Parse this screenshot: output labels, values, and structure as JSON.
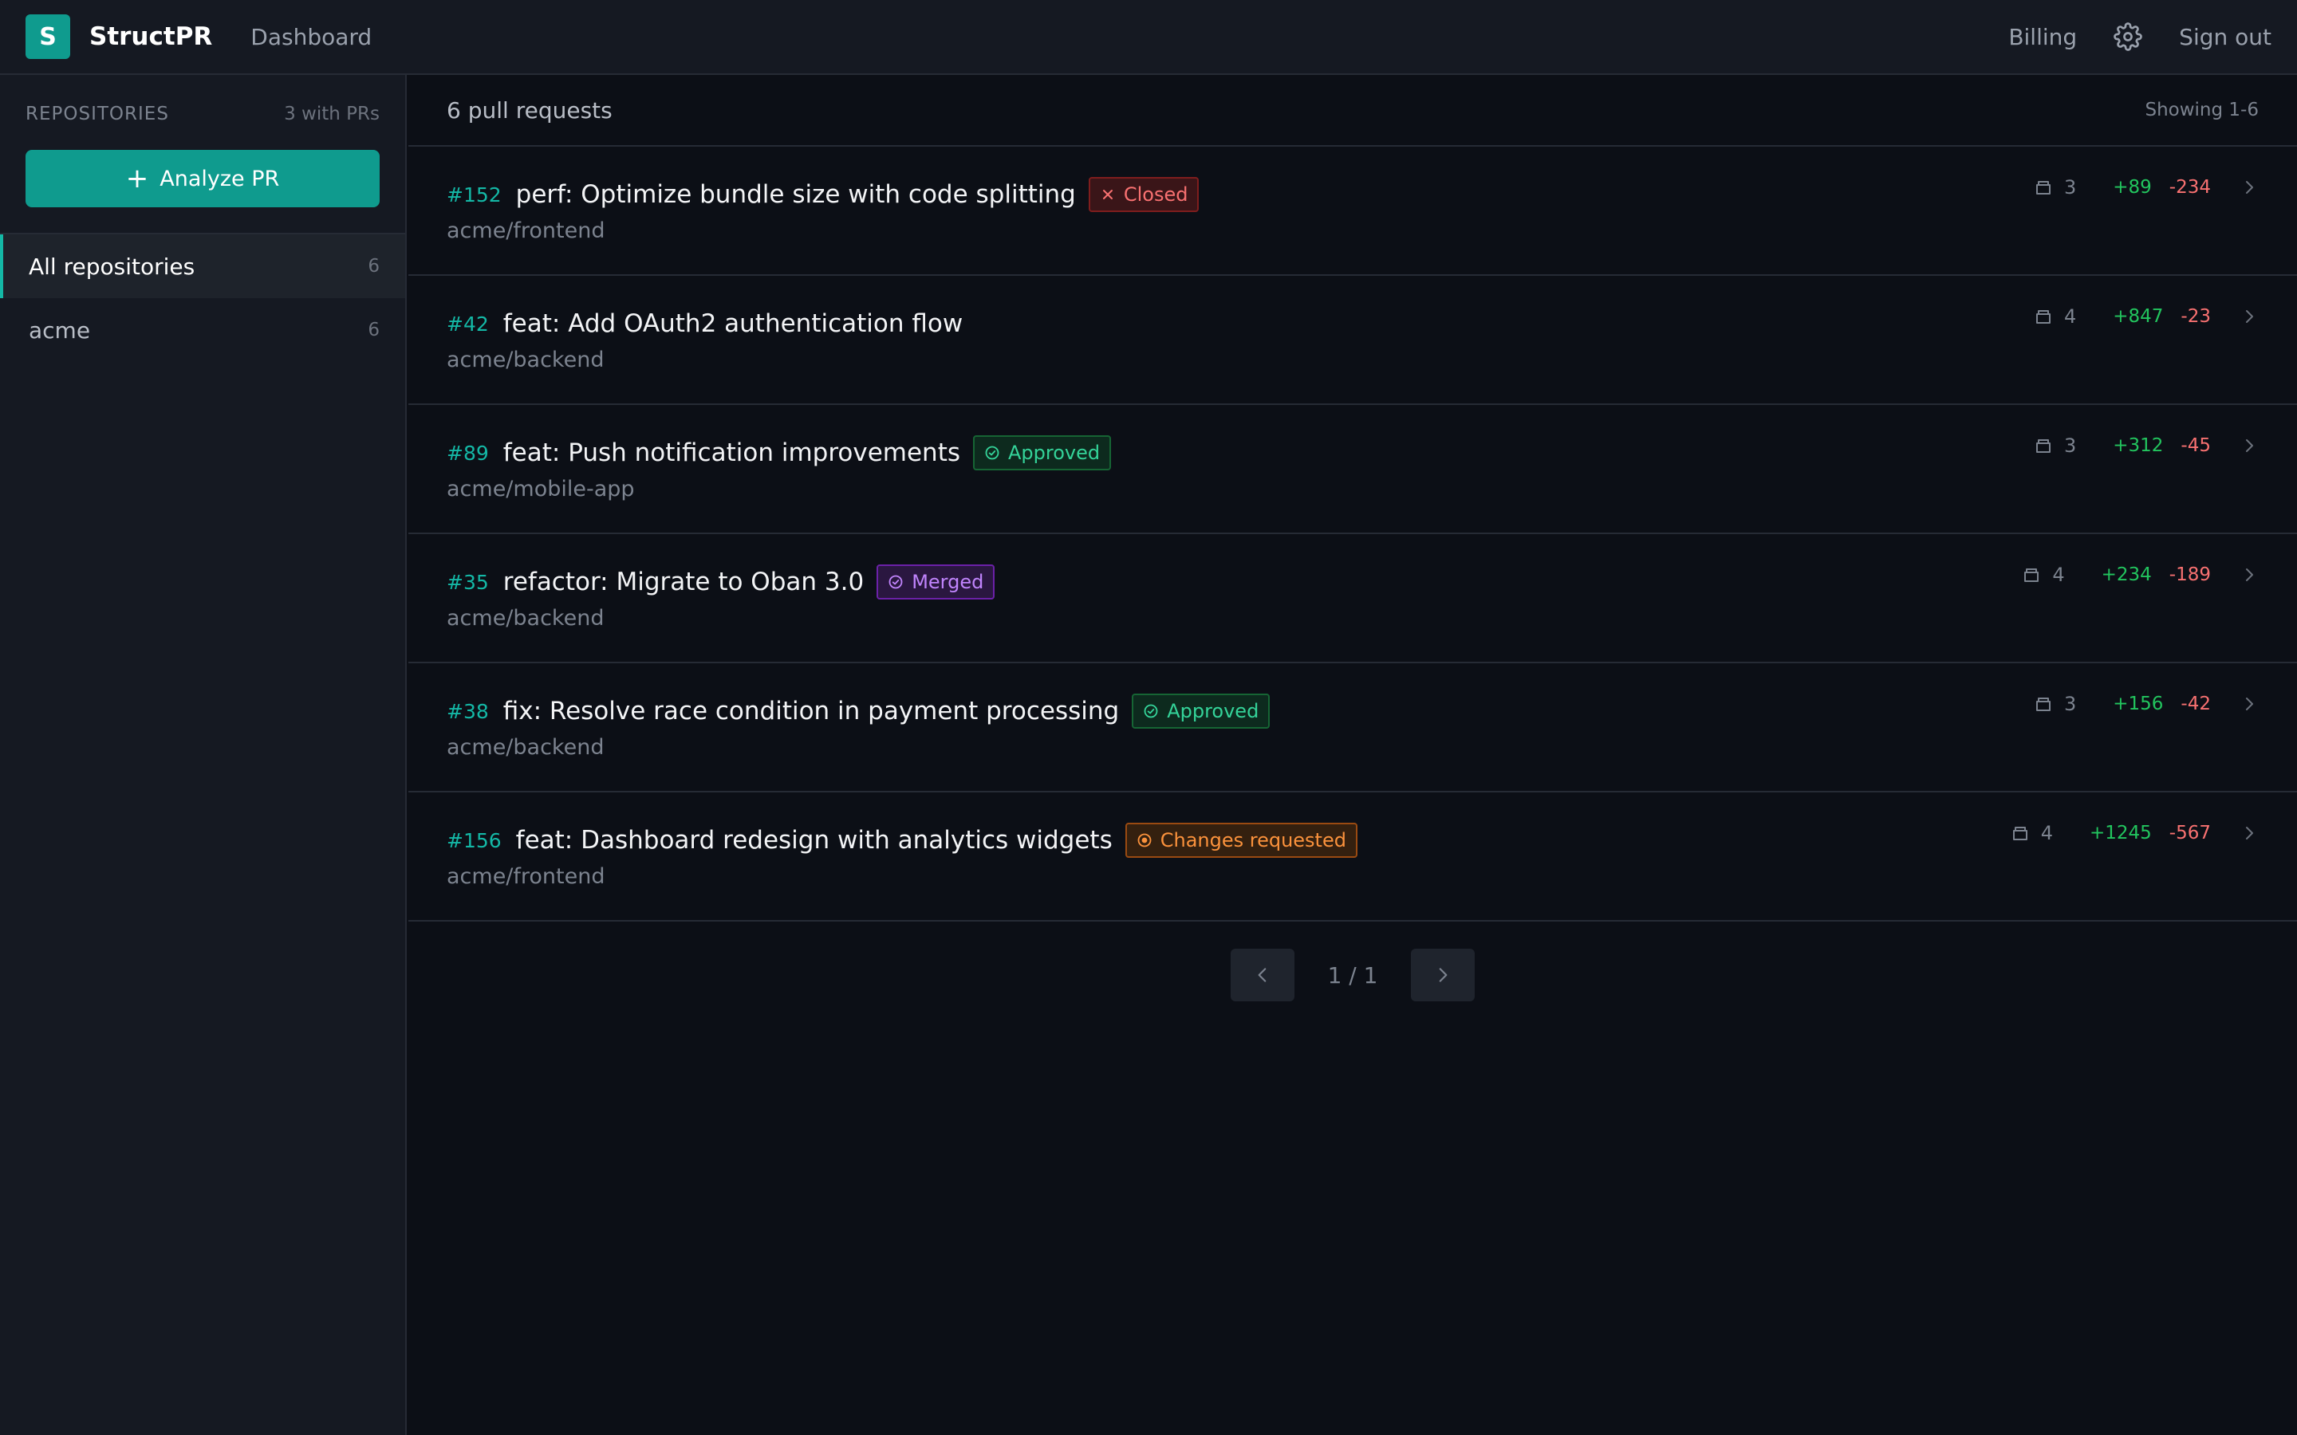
{
  "header": {
    "logo_letter": "S",
    "brand": "StructPR",
    "nav_dashboard": "Dashboard",
    "nav_billing": "Billing",
    "settings_icon": "gear-icon",
    "sign_out": "Sign out"
  },
  "sidebar": {
    "title": "REPOSITORIES",
    "count_label": "3 with PRs",
    "analyze_label": "Analyze PR",
    "items": [
      {
        "label": "All repositories",
        "count": "6"
      },
      {
        "label": "acme",
        "count": "6"
      }
    ]
  },
  "main": {
    "count_label": "6 pull requests",
    "showing_label": "Showing 1-6",
    "prs": [
      {
        "number": "#152",
        "title": "perf: Optimize bundle size with code splitting",
        "status": "Closed",
        "repo": "acme/frontend",
        "files": "3",
        "additions": "+89",
        "deletions": "-234"
      },
      {
        "number": "#42",
        "title": "feat: Add OAuth2 authentication flow",
        "status": "",
        "repo": "acme/backend",
        "files": "4",
        "additions": "+847",
        "deletions": "-23"
      },
      {
        "number": "#89",
        "title": "feat: Push notification improvements",
        "status": "Approved",
        "repo": "acme/mobile-app",
        "files": "3",
        "additions": "+312",
        "deletions": "-45"
      },
      {
        "number": "#35",
        "title": "refactor: Migrate to Oban 3.0",
        "status": "Merged",
        "repo": "acme/backend",
        "files": "4",
        "additions": "+234",
        "deletions": "-189"
      },
      {
        "number": "#38",
        "title": "fix: Resolve race condition in payment processing",
        "status": "Approved",
        "repo": "acme/backend",
        "files": "3",
        "additions": "+156",
        "deletions": "-42"
      },
      {
        "number": "#156",
        "title": "feat: Dashboard redesign with analytics widgets",
        "status": "Changes requested",
        "repo": "acme/frontend",
        "files": "4",
        "additions": "+1245",
        "deletions": "-567"
      }
    ],
    "pagination": "1 / 1"
  },
  "colors": {
    "accent": "#0f9b8e",
    "closed": "#f87171",
    "approved": "#34d399",
    "merged": "#c084fc",
    "changes_requested": "#fb923c"
  }
}
